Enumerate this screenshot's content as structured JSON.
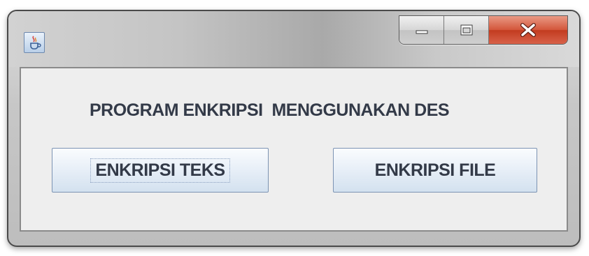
{
  "window": {
    "title": "",
    "icons": {
      "app": "java-cup-icon",
      "minimize": "minimize-icon",
      "maximize": "maximize-icon",
      "close": "close-icon"
    }
  },
  "main": {
    "heading": "PROGRAM ENKRIPSI  MENGGUNAKAN DES",
    "buttons": {
      "encrypt_text": "ENKRIPSI TEKS",
      "encrypt_file": "ENKRIPSI FILE"
    }
  },
  "colors": {
    "close_button": "#c23b1f",
    "text": "#333a48",
    "button_border": "#7c93b3"
  }
}
